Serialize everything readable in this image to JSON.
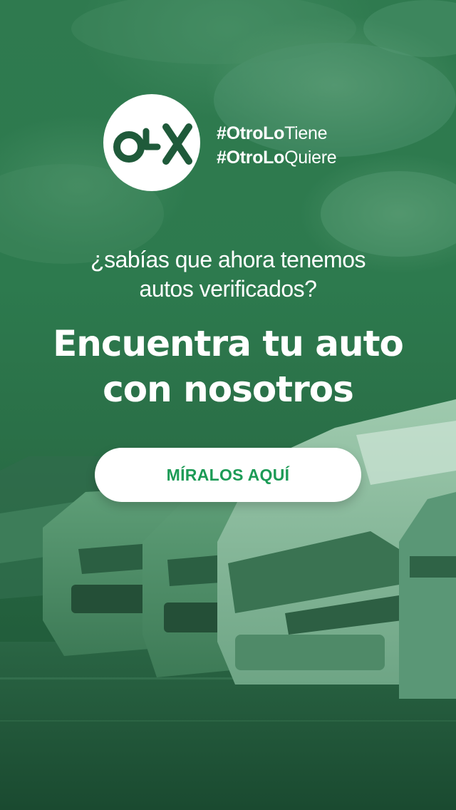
{
  "brand": {
    "logo_text": "OLX",
    "logo_icon": "olx-logo-icon",
    "text_color": "#1f5a3a",
    "circle_color": "#ffffff"
  },
  "hashtags": [
    {
      "bold": "#OtroLo",
      "light": "Tiene"
    },
    {
      "bold": "#OtroLo",
      "light": "Quiere"
    }
  ],
  "question": {
    "line1": "¿sabías que ahora tenemos",
    "line2": "autos verificados?"
  },
  "headline": {
    "line1": "Encuentra tu auto",
    "line2": "con nosotros"
  },
  "cta": {
    "label": "MÍRALOS AQUÍ",
    "text_color": "#1c9b56",
    "background": "#ffffff"
  },
  "background": {
    "scene": "cars-parked-row-under-cloudy-sky",
    "tint": "#2d7a4e"
  }
}
